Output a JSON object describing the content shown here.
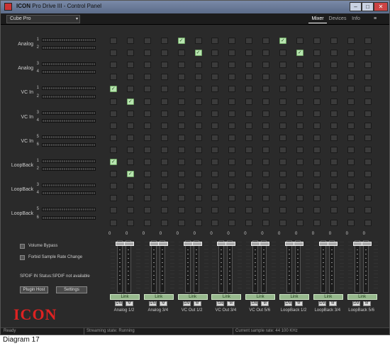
{
  "window": {
    "brand": "ICON",
    "title": "Pro Drive III - Control Panel",
    "buttons": {
      "minimize": "–",
      "maximize": "□",
      "close": "✕"
    }
  },
  "toolbar": {
    "device": "Cube Pro",
    "tabs": [
      "Mixer",
      "Devices",
      "Info"
    ],
    "active_tab": "Mixer",
    "menu_icon": "≡"
  },
  "inputs": [
    {
      "name": "Analog",
      "channels": [
        "1",
        "2"
      ]
    },
    {
      "name": "Analog",
      "channels": [
        "3",
        "4"
      ]
    },
    {
      "name": "VC In",
      "channels": [
        "1",
        "2"
      ]
    },
    {
      "name": "VC In",
      "channels": [
        "3",
        "4"
      ]
    },
    {
      "name": "VC In",
      "channels": [
        "5",
        "6"
      ]
    },
    {
      "name": "LoopBack",
      "channels": [
        "1",
        "2"
      ]
    },
    {
      "name": "LoopBack",
      "channels": [
        "3",
        "4"
      ]
    },
    {
      "name": "LoopBack",
      "channels": [
        "5",
        "6"
      ]
    }
  ],
  "matrix": {
    "rows": 16,
    "cols": 16,
    "active": [
      [
        0,
        4
      ],
      [
        1,
        5
      ],
      [
        0,
        10
      ],
      [
        1,
        11
      ],
      [
        4,
        0
      ],
      [
        5,
        1
      ],
      [
        10,
        0
      ],
      [
        11,
        1
      ]
    ],
    "check_glyph": "✓"
  },
  "outputs": [
    {
      "name": "Analog 1/2",
      "levels": [
        "0",
        "0"
      ],
      "link": "Link",
      "solo": "S/M",
      "mute": "M"
    },
    {
      "name": "Analog 3/4",
      "levels": [
        "0",
        "0"
      ],
      "link": "Link",
      "solo": "S/M",
      "mute": "M"
    },
    {
      "name": "VC Out 1/2",
      "levels": [
        "0",
        "0"
      ],
      "link": "Link",
      "solo": "S/M",
      "mute": "M"
    },
    {
      "name": "VC Out 3/4",
      "levels": [
        "0",
        "0"
      ],
      "link": "Link",
      "solo": "S/M",
      "mute": "M"
    },
    {
      "name": "VC Out 5/6",
      "levels": [
        "0",
        "0"
      ],
      "link": "Link",
      "solo": "S/M",
      "mute": "M"
    },
    {
      "name": "LoopBack 1/2",
      "levels": [
        "0",
        "0"
      ],
      "link": "Link",
      "solo": "S/M",
      "mute": "M"
    },
    {
      "name": "LoopBack 3/4",
      "levels": [
        "0",
        "0"
      ],
      "link": "Link",
      "solo": "S/M",
      "mute": "M"
    },
    {
      "name": "LoopBack 5/6",
      "levels": [
        "0",
        "0"
      ],
      "link": "Link",
      "solo": "S/M",
      "mute": "M"
    }
  ],
  "options": {
    "volume_bypass": "Volume Bypass",
    "forbid_sample_rate": "Forbid Sample Rate Change",
    "spdif_status": "SPDIF IN Status:SPDIF not available"
  },
  "actions": {
    "plugin_host": "Plugin Host",
    "settings": "Settings"
  },
  "logo": "ICON",
  "status": {
    "ready": "Ready",
    "streaming": "Streaming state: Running",
    "sample_rate": "Current sample rate: 44 100 KHz"
  },
  "caption": "Diagram 17",
  "colors": {
    "active_cell": "#b8e5b0",
    "link_button": "#96b88c",
    "logo": "#dd2222",
    "background": "#2a2a2a"
  }
}
